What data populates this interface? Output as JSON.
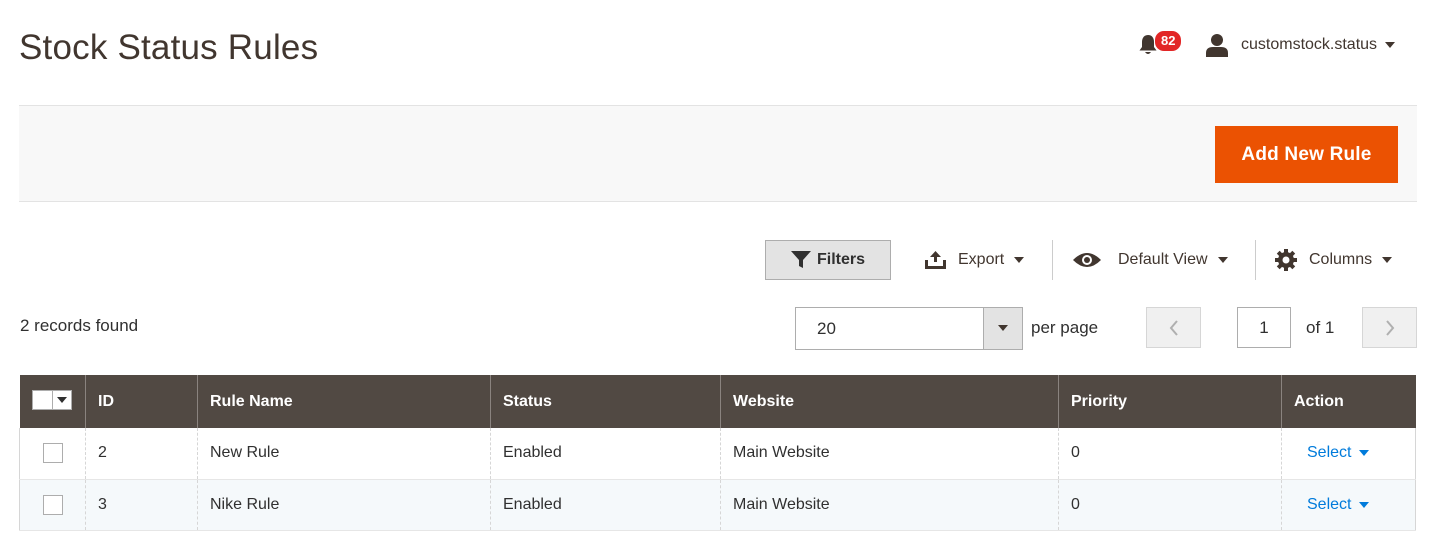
{
  "header": {
    "title": "Stock Status Rules",
    "notifications_count": "82",
    "user_name": "customstock.status"
  },
  "actions": {
    "add_new_rule": "Add New Rule"
  },
  "toolbar": {
    "filters": "Filters",
    "export": "Export",
    "default_view": "Default View",
    "columns": "Columns"
  },
  "listing": {
    "records_found": "2 records found",
    "per_page_value": "20",
    "per_page_label": "per page",
    "current_page": "1",
    "of_pages": "of 1"
  },
  "grid": {
    "columns": [
      "ID",
      "Rule Name",
      "Status",
      "Website",
      "Priority",
      "Action"
    ],
    "rows": [
      {
        "id": "2",
        "rule_name": "New Rule",
        "status": "Enabled",
        "website": "Main Website",
        "priority": "0",
        "action": "Select"
      },
      {
        "id": "3",
        "rule_name": "Nike Rule",
        "status": "Enabled",
        "website": "Main Website",
        "priority": "0",
        "action": "Select"
      }
    ]
  },
  "colors": {
    "accent": "#eb5202",
    "grid_header": "#514943",
    "link": "#007bdb",
    "badge": "#e22626"
  },
  "icons": [
    "bell-icon",
    "user-icon",
    "filter-icon",
    "export-icon",
    "eye-icon",
    "gear-icon",
    "chevron-left-icon",
    "chevron-right-icon"
  ]
}
